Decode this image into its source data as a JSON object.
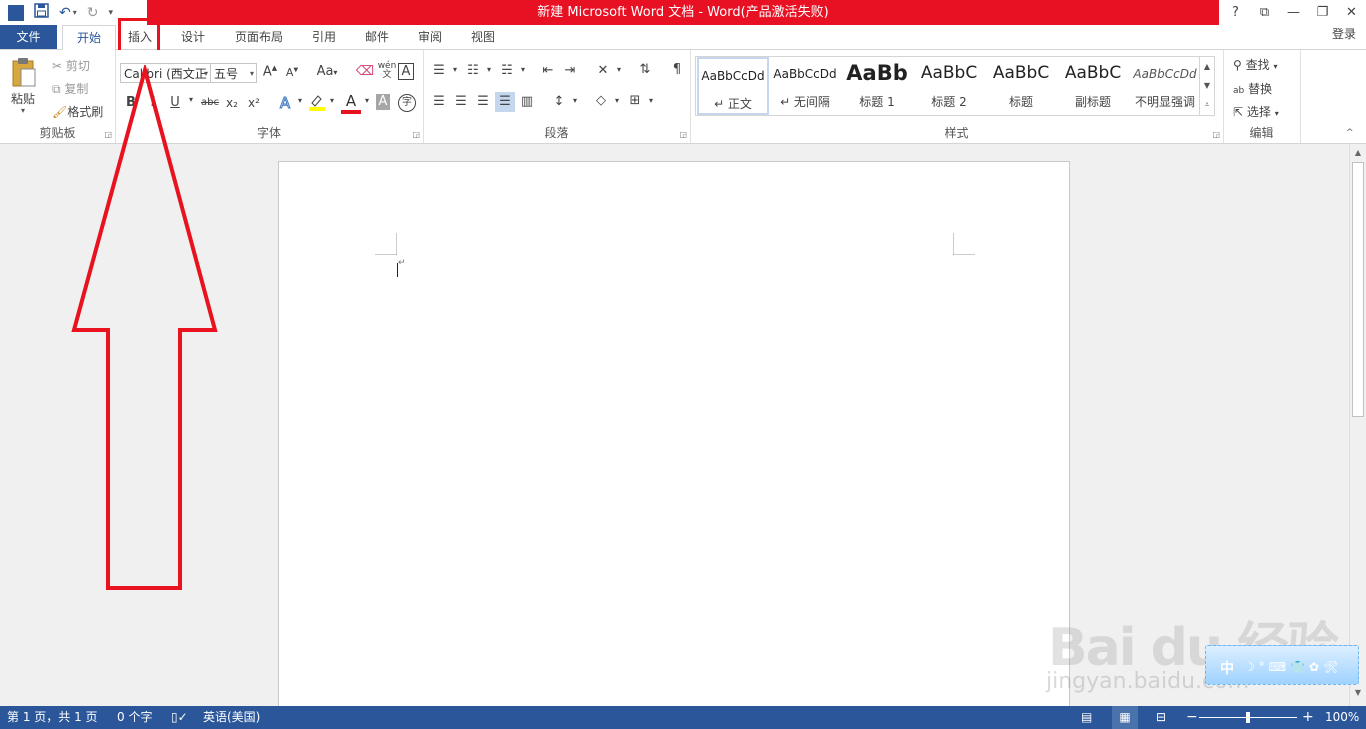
{
  "window": {
    "title": "新建 Microsoft Word 文档 -  Word(产品激活失败)",
    "controls": [
      "?",
      "⧉",
      "—",
      "❐",
      "✕"
    ]
  },
  "qat": {
    "logo": "W"
  },
  "tabs": {
    "file": "文件",
    "home": "开始",
    "insert": "插入",
    "design": "设计",
    "layout": "页面布局",
    "references": "引用",
    "mailings": "邮件",
    "review": "审阅",
    "view": "视图",
    "login": "登录"
  },
  "clipboard": {
    "paste": "粘贴",
    "cut": "剪切",
    "copy": "复制",
    "format_painter": "格式刷",
    "label": "剪贴板"
  },
  "font": {
    "name": "Calibri (西文正",
    "size": "五号",
    "grow": "A",
    "shrink": "A",
    "change_case": "Aa",
    "phonetic": "wén",
    "char_border": "A",
    "bold": "B",
    "italic": "I",
    "underline": "U",
    "strike": "abc",
    "subscript": "x₂",
    "superscript": "x²",
    "text_effects": "A",
    "font_color": "A",
    "shading": "A",
    "enclose": "字",
    "label": "字体"
  },
  "paragraph": {
    "label": "段落"
  },
  "styles": {
    "label": "样式",
    "items": [
      {
        "sample": "AaBbCcDd",
        "name": "↵ 正文"
      },
      {
        "sample": "AaBbCcDd",
        "name": "↵ 无间隔"
      },
      {
        "sample": "AaBb",
        "name": "标题 1"
      },
      {
        "sample": "AaBbC",
        "name": "标题 2"
      },
      {
        "sample": "AaBbC",
        "name": "标题"
      },
      {
        "sample": "AaBbC",
        "name": "副标题"
      },
      {
        "sample": "AaBbCcDd",
        "name": "不明显强调"
      }
    ]
  },
  "editing": {
    "find": "查找",
    "replace": "替换",
    "select": "选择",
    "label": "编辑"
  },
  "status": {
    "page": "第 1 页，共 1 页",
    "words": "0 个字",
    "language": "英语(美国)",
    "zoom": "100%",
    "zoom_minus": "−",
    "zoom_plus": "+"
  },
  "watermark": {
    "brand": "Bai du 经验",
    "url": "jingyan.baidu.com",
    "ime": "中"
  },
  "colors": {
    "accent": "#2b579a",
    "titlebar": "#e81123",
    "annotation": "#e8131e"
  }
}
